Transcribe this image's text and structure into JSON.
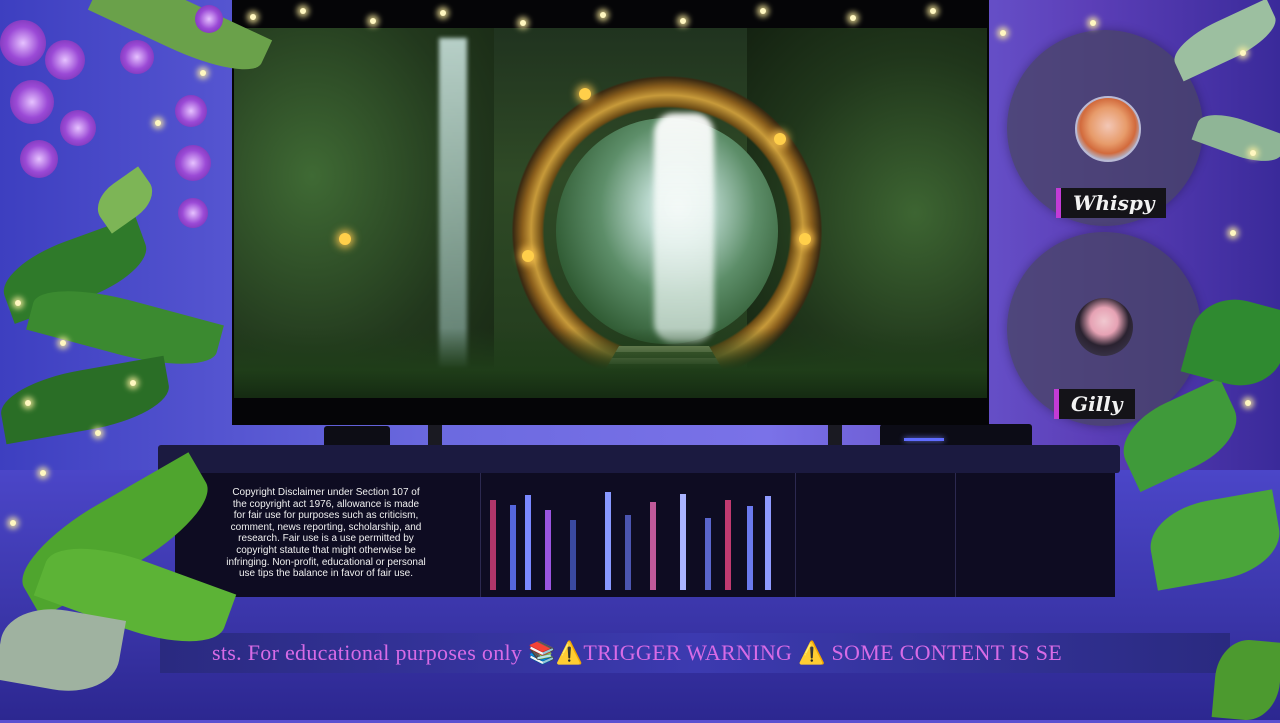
{
  "tv": {
    "scene": "forest-portal-waterfall"
  },
  "disclaimer": {
    "text": "Copyright Disclaimer under Section 107 of the copyright act 1976, allowance is made for fair use for purposes such as criticism, comment, news reporting, scholarship, and research. Fair use is a use permitted by copyright statute that might otherwise be infringing. Non-profit, educational or personal use tips the balance in favor of fair use."
  },
  "ticker": {
    "text": "sts. For educational purposes only 📚⚠️TRIGGER WARNING ⚠️ SOME CONTENT IS SE"
  },
  "hosts": [
    {
      "name": "Whispy"
    },
    {
      "name": "Gilly"
    }
  ],
  "colors": {
    "wall": "#6c6ae0",
    "nameTagAccent": "#c23bd6",
    "tickerText": "#d86be6",
    "flower": "#9b4ad6"
  }
}
